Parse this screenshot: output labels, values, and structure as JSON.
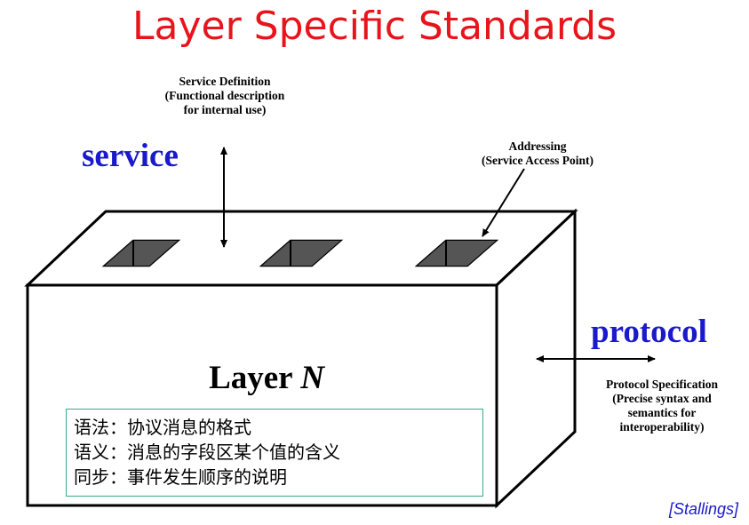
{
  "title": "Layer Specific Standards",
  "service_label": "service",
  "protocol_label": "protocol",
  "service_definition": {
    "line1": "Service Definition",
    "line2": "(Functional description",
    "line3": "for internal use)"
  },
  "addressing": {
    "line1": "Addressing",
    "line2": "(Service Access Point)"
  },
  "protocol_spec": {
    "line1": "Protocol Specification",
    "line2": "(Precise syntax and",
    "line3": "semantics for",
    "line4": "interoperability)"
  },
  "layer": {
    "label": "Layer",
    "n": "N"
  },
  "notes": [
    "语法：协议消息的格式",
    "语义：消息的字段区某个值的含义",
    "同步：事件发生顺序的说明"
  ],
  "citation": "[Stallings]"
}
